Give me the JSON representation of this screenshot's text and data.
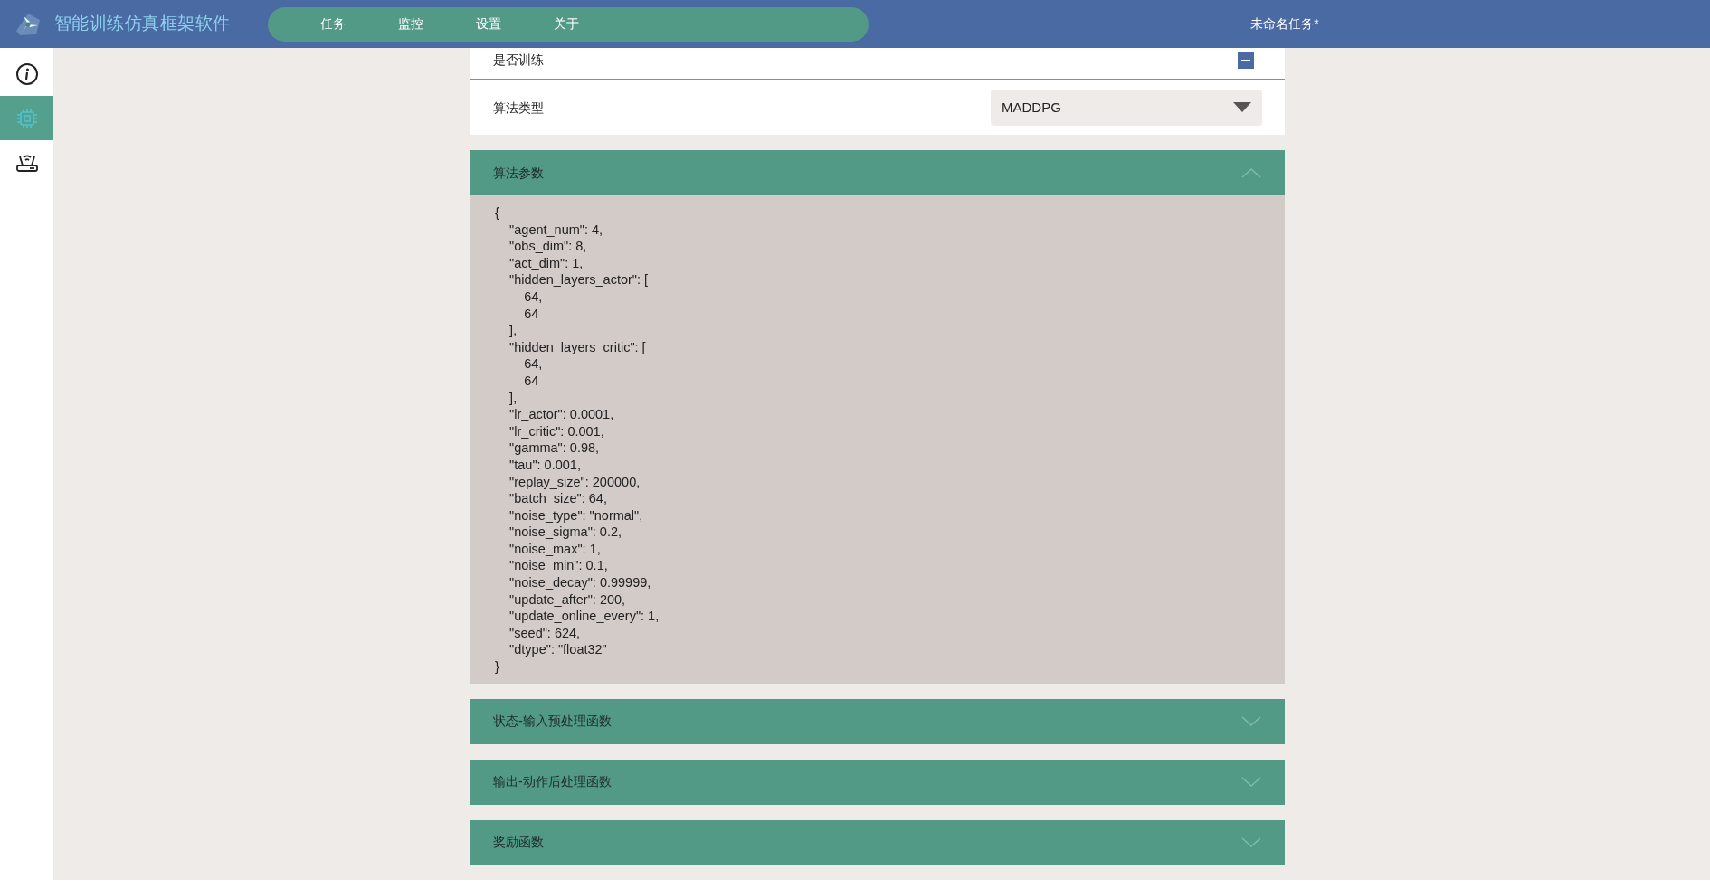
{
  "header": {
    "app_title": "智能训练仿真框架软件",
    "nav": [
      {
        "label": "任务"
      },
      {
        "label": "监控"
      },
      {
        "label": "设置"
      },
      {
        "label": "关于"
      }
    ],
    "task_title": "未命名任务*"
  },
  "sidebar": {
    "items": [
      {
        "kind": "info",
        "selected": false
      },
      {
        "kind": "chip",
        "selected": true
      },
      {
        "kind": "router",
        "selected": false
      }
    ]
  },
  "settings": [
    {
      "label": "是否训练",
      "kind": "checkbox",
      "checked": true
    },
    {
      "label": "算法类型",
      "kind": "select",
      "value": "MADDPG"
    }
  ],
  "sections": [
    {
      "title": "算法参数",
      "expanded": true,
      "content": "{\n    \"agent_num\": 4,\n    \"obs_dim\": 8,\n    \"act_dim\": 1,\n    \"hidden_layers_actor\": [\n        64,\n        64\n    ],\n    \"hidden_layers_critic\": [\n        64,\n        64\n    ],\n    \"lr_actor\": 0.0001,\n    \"lr_critic\": 0.001,\n    \"gamma\": 0.98,\n    \"tau\": 0.001,\n    \"replay_size\": 200000,\n    \"batch_size\": 64,\n    \"noise_type\": \"normal\",\n    \"noise_sigma\": 0.2,\n    \"noise_max\": 1,\n    \"noise_min\": 0.1,\n    \"noise_decay\": 0.99999,\n    \"update_after\": 200,\n    \"update_online_every\": 1,\n    \"seed\": 624,\n    \"dtype\": \"float32\"\n}"
    },
    {
      "title": "状态-输入预处理函数",
      "expanded": false
    },
    {
      "title": "输出-动作后处理函数",
      "expanded": false
    },
    {
      "title": "奖励函数",
      "expanded": false
    }
  ]
}
